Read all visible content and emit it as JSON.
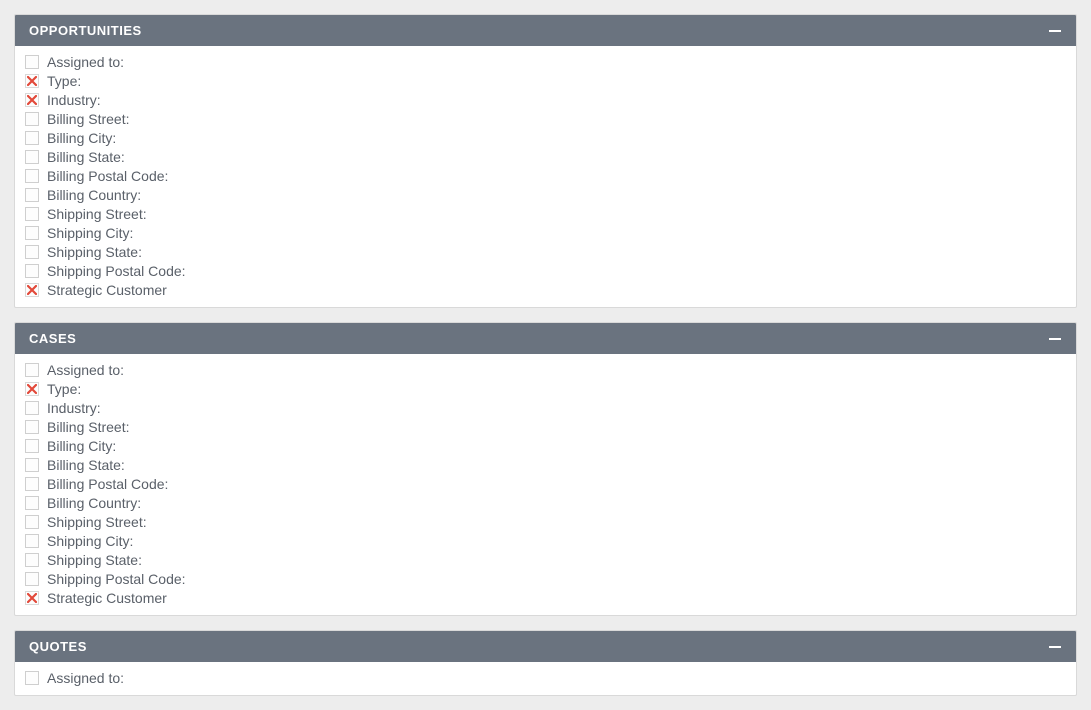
{
  "panels": [
    {
      "title": "OPPORTUNITIES",
      "fields": [
        {
          "label": "Assigned to:",
          "checked": false
        },
        {
          "label": "Type:",
          "checked": true
        },
        {
          "label": "Industry:",
          "checked": true
        },
        {
          "label": "Billing Street:",
          "checked": false
        },
        {
          "label": "Billing City:",
          "checked": false
        },
        {
          "label": "Billing State:",
          "checked": false
        },
        {
          "label": "Billing Postal Code:",
          "checked": false
        },
        {
          "label": "Billing Country:",
          "checked": false
        },
        {
          "label": "Shipping Street:",
          "checked": false
        },
        {
          "label": "Shipping City:",
          "checked": false
        },
        {
          "label": "Shipping State:",
          "checked": false
        },
        {
          "label": "Shipping Postal Code:",
          "checked": false
        },
        {
          "label": "Strategic Customer",
          "checked": true
        }
      ]
    },
    {
      "title": "CASES",
      "fields": [
        {
          "label": "Assigned to:",
          "checked": false
        },
        {
          "label": "Type:",
          "checked": true
        },
        {
          "label": "Industry:",
          "checked": false
        },
        {
          "label": "Billing Street:",
          "checked": false
        },
        {
          "label": "Billing City:",
          "checked": false
        },
        {
          "label": "Billing State:",
          "checked": false
        },
        {
          "label": "Billing Postal Code:",
          "checked": false
        },
        {
          "label": "Billing Country:",
          "checked": false
        },
        {
          "label": "Shipping Street:",
          "checked": false
        },
        {
          "label": "Shipping City:",
          "checked": false
        },
        {
          "label": "Shipping State:",
          "checked": false
        },
        {
          "label": "Shipping Postal Code:",
          "checked": false
        },
        {
          "label": "Strategic Customer",
          "checked": true
        }
      ]
    },
    {
      "title": "QUOTES",
      "fields": [
        {
          "label": "Assigned to:",
          "checked": false
        }
      ]
    }
  ]
}
